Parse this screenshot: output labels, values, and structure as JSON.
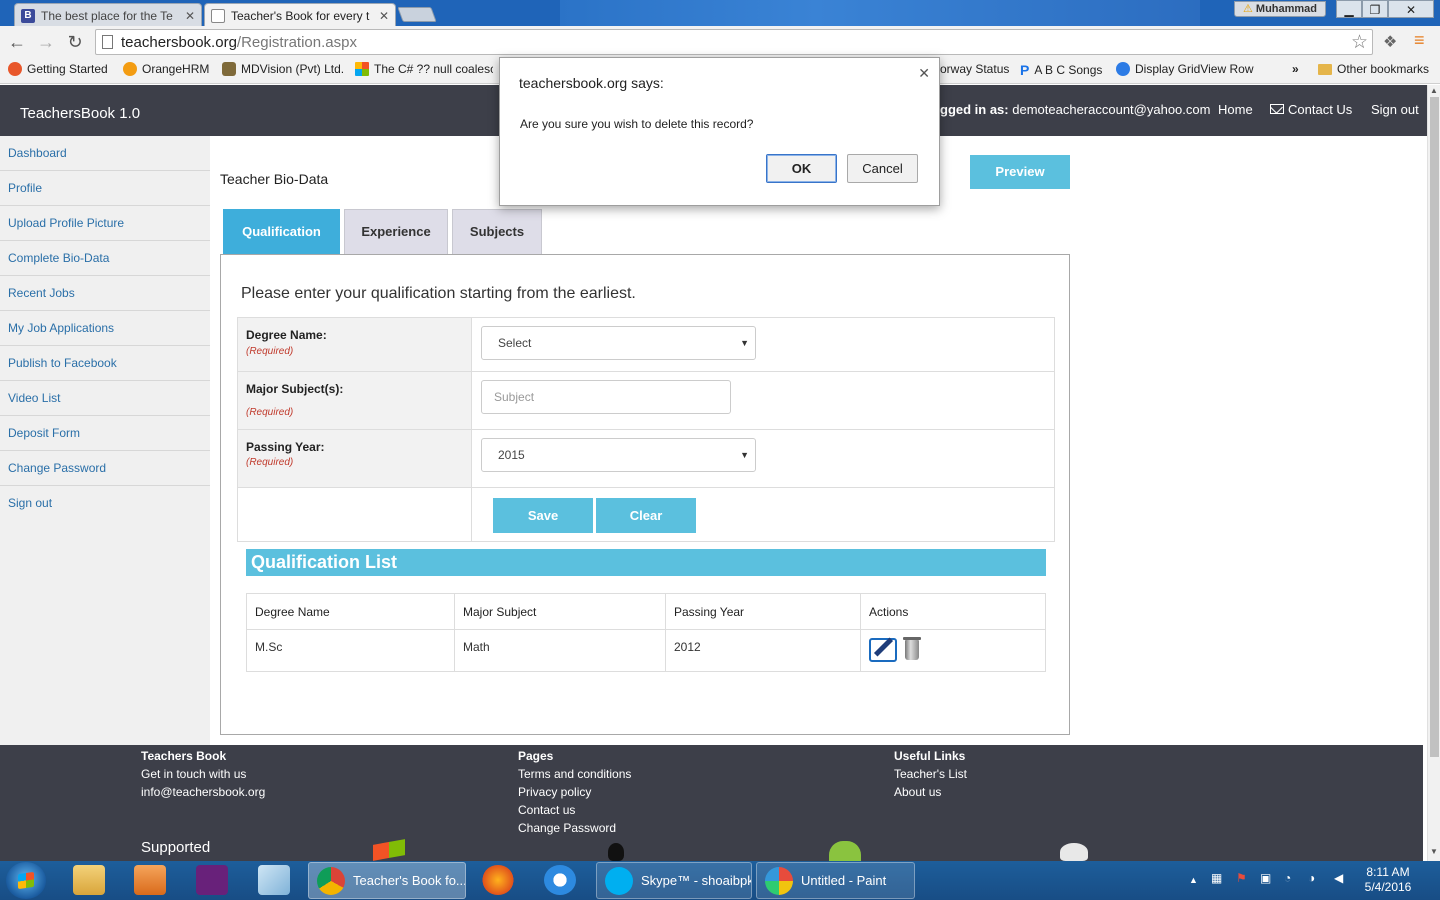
{
  "browser": {
    "tabs": [
      {
        "label": "The best place for the Te",
        "icon": "blogger-icon",
        "active": false
      },
      {
        "label": "Teacher's Book for every t",
        "icon": "page-icon",
        "active": true
      }
    ],
    "profile_name": "Muhammad",
    "address": {
      "host": "teachersbook.org",
      "path": "/Registration.aspx"
    },
    "bookmarks": [
      {
        "label": "Getting Started",
        "color": "#e8572b"
      },
      {
        "label": "OrangeHRM",
        "color": "#f39c12"
      },
      {
        "label": "MDVision (Pvt) Ltd.",
        "color": "#7f6a3a"
      },
      {
        "label": "The C# ?? null coalesc",
        "color": "#e74c3c"
      },
      {
        "label": "orway Status",
        "color": "#888888"
      },
      {
        "label": "A B C Songs",
        "color": "#1a73e8"
      },
      {
        "label": "Display GridView Row",
        "color": "#2c7be5"
      },
      {
        "label": "»",
        "color": ""
      },
      {
        "label": "Other bookmarks",
        "color": "#e5b54a"
      }
    ]
  },
  "header": {
    "brand": "TeachersBook 1.0",
    "logged_prefix": "gged in as:",
    "logged_email": "demoteacheraccount@yahoo.com",
    "nav": [
      "Home",
      "Contact Us",
      "Sign out"
    ]
  },
  "sidebar": {
    "items": [
      "Dashboard",
      "Profile",
      "Upload Profile Picture",
      "Complete Bio-Data",
      "Recent Jobs",
      "My Job Applications",
      "Publish to Facebook",
      "Video List",
      "Deposit Form",
      "Change Password",
      "Sign out"
    ]
  },
  "main": {
    "title": "Teacher Bio-Data",
    "preview_label": "Preview",
    "tabs": [
      "Qualification",
      "Experience",
      "Subjects"
    ],
    "instructions": "Please enter your qualification starting from the earliest.",
    "form": {
      "degree_label": "Degree Name:",
      "degree_value": "Select",
      "major_label": "Major Subject(s):",
      "major_placeholder": "Subject",
      "year_label": "Passing Year:",
      "year_value": "2015",
      "required": "(Required)",
      "save_label": "Save",
      "clear_label": "Clear"
    },
    "list_title": "Qualification List",
    "columns": [
      "Degree Name",
      "Major Subject",
      "Passing Year",
      "Actions"
    ],
    "rows": [
      {
        "degree": "M.Sc",
        "major": "Math",
        "year": "2012"
      }
    ]
  },
  "dialog": {
    "title": "teachersbook.org says:",
    "message": "Are you sure you wish to delete this record?",
    "ok": "OK",
    "cancel": "Cancel"
  },
  "footer": {
    "col1": {
      "heading": "Teachers Book",
      "lines": [
        "Get in touch with us",
        "info@teachersbook.org"
      ]
    },
    "col2": {
      "heading": "Pages",
      "lines": [
        "Terms and conditions",
        "Privacy policy",
        "Contact us",
        "Change Password"
      ]
    },
    "col3": {
      "heading": "Useful Links",
      "lines": [
        "Teacher's List",
        "About us"
      ]
    },
    "supported": "Supported"
  },
  "taskbar": {
    "tasks": [
      "Teacher's Book fo...",
      "Skype™ - shoaibpk",
      "Untitled - Paint"
    ],
    "time": "8:11 AM",
    "date": "5/4/2016"
  }
}
